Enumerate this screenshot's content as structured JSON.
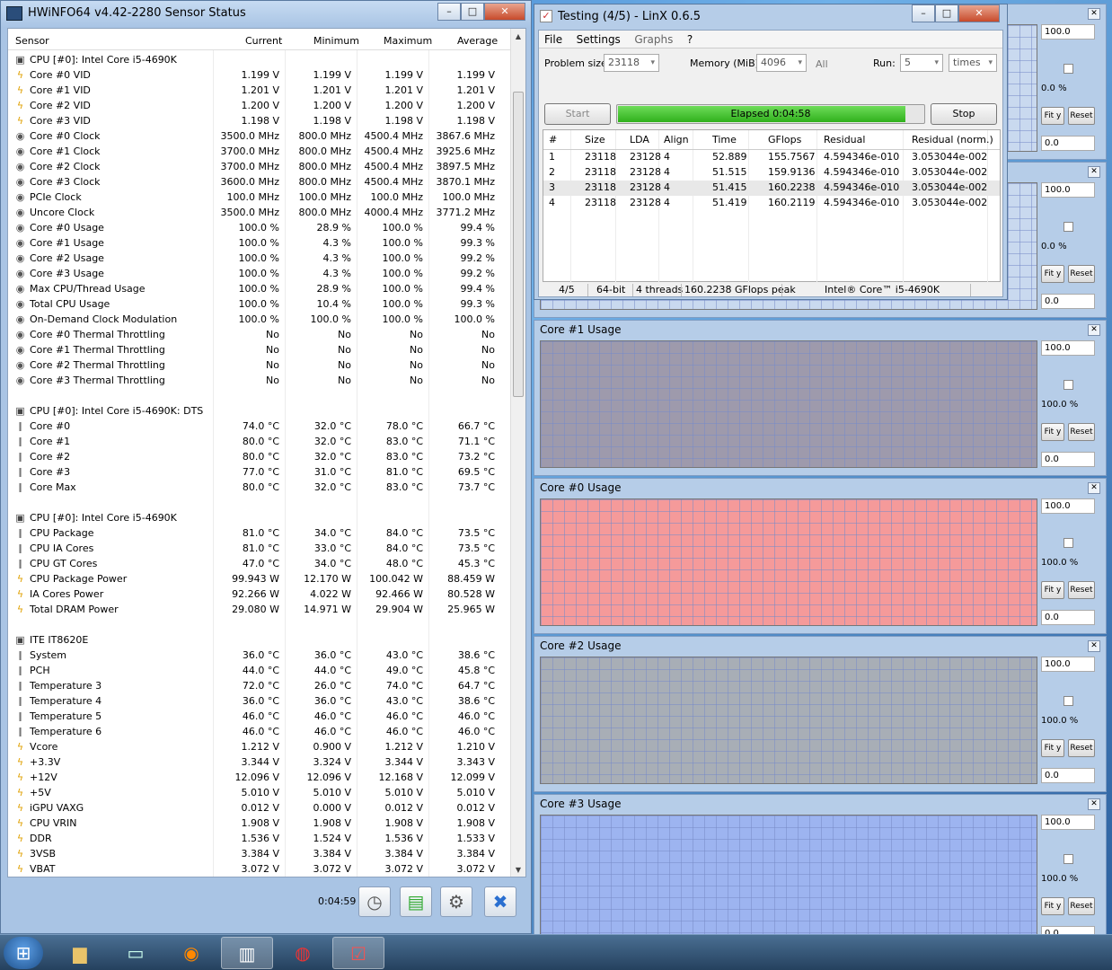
{
  "hwinfo": {
    "title": "HWiNFO64 v4.42-2280 Sensor Status",
    "columns": [
      "Sensor",
      "Current",
      "Minimum",
      "Maximum",
      "Average"
    ],
    "rows": [
      {
        "i": "cpu",
        "n": "CPU [#0]: Intel Core i5-4690K",
        "g": true
      },
      {
        "i": "volt",
        "n": "Core #0 VID",
        "v": [
          "1.199 V",
          "1.199 V",
          "1.199 V",
          "1.199 V"
        ]
      },
      {
        "i": "volt",
        "n": "Core #1 VID",
        "v": [
          "1.201 V",
          "1.201 V",
          "1.201 V",
          "1.201 V"
        ]
      },
      {
        "i": "volt",
        "n": "Core #2 VID",
        "v": [
          "1.200 V",
          "1.200 V",
          "1.200 V",
          "1.200 V"
        ]
      },
      {
        "i": "volt",
        "n": "Core #3 VID",
        "v": [
          "1.198 V",
          "1.198 V",
          "1.198 V",
          "1.198 V"
        ]
      },
      {
        "i": "clock",
        "n": "Core #0 Clock",
        "v": [
          "3500.0 MHz",
          "800.0 MHz",
          "4500.4 MHz",
          "3867.6 MHz"
        ]
      },
      {
        "i": "clock",
        "n": "Core #1 Clock",
        "v": [
          "3700.0 MHz",
          "800.0 MHz",
          "4500.4 MHz",
          "3925.6 MHz"
        ]
      },
      {
        "i": "clock",
        "n": "Core #2 Clock",
        "v": [
          "3700.0 MHz",
          "800.0 MHz",
          "4500.4 MHz",
          "3897.5 MHz"
        ]
      },
      {
        "i": "clock",
        "n": "Core #3 Clock",
        "v": [
          "3600.0 MHz",
          "800.0 MHz",
          "4500.4 MHz",
          "3870.1 MHz"
        ]
      },
      {
        "i": "clock",
        "n": "PCIe Clock",
        "v": [
          "100.0 MHz",
          "100.0 MHz",
          "100.0 MHz",
          "100.0 MHz"
        ]
      },
      {
        "i": "clock",
        "n": "Uncore Clock",
        "v": [
          "3500.0 MHz",
          "800.0 MHz",
          "4000.4 MHz",
          "3771.2 MHz"
        ]
      },
      {
        "i": "clock",
        "n": "Core #0 Usage",
        "v": [
          "100.0 %",
          "28.9 %",
          "100.0 %",
          "99.4 %"
        ]
      },
      {
        "i": "clock",
        "n": "Core #1 Usage",
        "v": [
          "100.0 %",
          "4.3 %",
          "100.0 %",
          "99.3 %"
        ]
      },
      {
        "i": "clock",
        "n": "Core #2 Usage",
        "v": [
          "100.0 %",
          "4.3 %",
          "100.0 %",
          "99.2 %"
        ]
      },
      {
        "i": "clock",
        "n": "Core #3 Usage",
        "v": [
          "100.0 %",
          "4.3 %",
          "100.0 %",
          "99.2 %"
        ]
      },
      {
        "i": "clock",
        "n": "Max CPU/Thread Usage",
        "v": [
          "100.0 %",
          "28.9 %",
          "100.0 %",
          "99.4 %"
        ]
      },
      {
        "i": "clock",
        "n": "Total CPU Usage",
        "v": [
          "100.0 %",
          "10.4 %",
          "100.0 %",
          "99.3 %"
        ]
      },
      {
        "i": "clock",
        "n": "On-Demand Clock Modulation",
        "v": [
          "100.0 %",
          "100.0 %",
          "100.0 %",
          "100.0 %"
        ]
      },
      {
        "i": "clock",
        "n": "Core #0 Thermal Throttling",
        "v": [
          "No",
          "No",
          "No",
          "No"
        ]
      },
      {
        "i": "clock",
        "n": "Core #1 Thermal Throttling",
        "v": [
          "No",
          "No",
          "No",
          "No"
        ]
      },
      {
        "i": "clock",
        "n": "Core #2 Thermal Throttling",
        "v": [
          "No",
          "No",
          "No",
          "No"
        ]
      },
      {
        "i": "clock",
        "n": "Core #3 Thermal Throttling",
        "v": [
          "No",
          "No",
          "No",
          "No"
        ]
      },
      {
        "i": "",
        "n": "",
        "sp": true
      },
      {
        "i": "cpu",
        "n": "CPU [#0]: Intel Core i5-4690K: DTS",
        "g": true
      },
      {
        "i": "temp",
        "n": "Core #0",
        "v": [
          "74.0 °C",
          "32.0 °C",
          "78.0 °C",
          "66.7 °C"
        ]
      },
      {
        "i": "temp",
        "n": "Core #1",
        "v": [
          "80.0 °C",
          "32.0 °C",
          "83.0 °C",
          "71.1 °C"
        ]
      },
      {
        "i": "temp",
        "n": "Core #2",
        "v": [
          "80.0 °C",
          "32.0 °C",
          "83.0 °C",
          "73.2 °C"
        ]
      },
      {
        "i": "temp",
        "n": "Core #3",
        "v": [
          "77.0 °C",
          "31.0 °C",
          "81.0 °C",
          "69.5 °C"
        ]
      },
      {
        "i": "temp",
        "n": "Core Max",
        "v": [
          "80.0 °C",
          "32.0 °C",
          "83.0 °C",
          "73.7 °C"
        ]
      },
      {
        "i": "",
        "n": "",
        "sp": true
      },
      {
        "i": "cpu",
        "n": "CPU [#0]: Intel Core i5-4690K",
        "g": true
      },
      {
        "i": "temp",
        "n": "CPU Package",
        "v": [
          "81.0 °C",
          "34.0 °C",
          "84.0 °C",
          "73.5 °C"
        ]
      },
      {
        "i": "temp",
        "n": "CPU IA Cores",
        "v": [
          "81.0 °C",
          "33.0 °C",
          "84.0 °C",
          "73.5 °C"
        ]
      },
      {
        "i": "temp",
        "n": "CPU GT Cores",
        "v": [
          "47.0 °C",
          "34.0 °C",
          "48.0 °C",
          "45.3 °C"
        ]
      },
      {
        "i": "volt",
        "n": "CPU Package Power",
        "v": [
          "99.943 W",
          "12.170 W",
          "100.042 W",
          "88.459 W"
        ]
      },
      {
        "i": "volt",
        "n": "IA Cores Power",
        "v": [
          "92.266 W",
          "4.022 W",
          "92.466 W",
          "80.528 W"
        ]
      },
      {
        "i": "volt",
        "n": "Total DRAM Power",
        "v": [
          "29.080 W",
          "14.971 W",
          "29.904 W",
          "25.965 W"
        ]
      },
      {
        "i": "",
        "n": "",
        "sp": true
      },
      {
        "i": "cpu",
        "n": "ITE IT8620E",
        "g": true
      },
      {
        "i": "temp",
        "n": "System",
        "v": [
          "36.0 °C",
          "36.0 °C",
          "43.0 °C",
          "38.6 °C"
        ]
      },
      {
        "i": "temp",
        "n": "PCH",
        "v": [
          "44.0 °C",
          "44.0 °C",
          "49.0 °C",
          "45.8 °C"
        ]
      },
      {
        "i": "temp",
        "n": "Temperature 3",
        "v": [
          "72.0 °C",
          "26.0 °C",
          "74.0 °C",
          "64.7 °C"
        ]
      },
      {
        "i": "temp",
        "n": "Temperature 4",
        "v": [
          "36.0 °C",
          "36.0 °C",
          "43.0 °C",
          "38.6 °C"
        ]
      },
      {
        "i": "temp",
        "n": "Temperature 5",
        "v": [
          "46.0 °C",
          "46.0 °C",
          "46.0 °C",
          "46.0 °C"
        ]
      },
      {
        "i": "temp",
        "n": "Temperature 6",
        "v": [
          "46.0 °C",
          "46.0 °C",
          "46.0 °C",
          "46.0 °C"
        ]
      },
      {
        "i": "volt",
        "n": "Vcore",
        "v": [
          "1.212 V",
          "0.900 V",
          "1.212 V",
          "1.210 V"
        ]
      },
      {
        "i": "volt",
        "n": "+3.3V",
        "v": [
          "3.344 V",
          "3.324 V",
          "3.344 V",
          "3.343 V"
        ]
      },
      {
        "i": "volt",
        "n": "+12V",
        "v": [
          "12.096 V",
          "12.096 V",
          "12.168 V",
          "12.099 V"
        ]
      },
      {
        "i": "volt",
        "n": "+5V",
        "v": [
          "5.010 V",
          "5.010 V",
          "5.010 V",
          "5.010 V"
        ]
      },
      {
        "i": "volt",
        "n": "iGPU VAXG",
        "v": [
          "0.012 V",
          "0.000 V",
          "0.012 V",
          "0.012 V"
        ]
      },
      {
        "i": "volt",
        "n": "CPU VRIN",
        "v": [
          "1.908 V",
          "1.908 V",
          "1.908 V",
          "1.908 V"
        ]
      },
      {
        "i": "volt",
        "n": "DDR",
        "v": [
          "1.536 V",
          "1.524 V",
          "1.536 V",
          "1.533 V"
        ]
      },
      {
        "i": "volt",
        "n": "3VSB",
        "v": [
          "3.384 V",
          "3.384 V",
          "3.384 V",
          "3.384 V"
        ]
      },
      {
        "i": "volt",
        "n": "VBAT",
        "v": [
          "3.072 V",
          "3.072 V",
          "3.072 V",
          "3.072 V"
        ]
      }
    ],
    "elapsed": "0:04:59"
  },
  "linx": {
    "title": "Testing (4/5) - LinX 0.6.5",
    "menu": [
      "File",
      "Settings",
      "Graphs",
      "?"
    ],
    "problem_size_label": "Problem size:",
    "problem_size": "23118",
    "memory_label": "Memory (MiB):",
    "memory": "4096",
    "all_label": "All",
    "run_label": "Run:",
    "run": "5",
    "times": "times",
    "start": "Start",
    "stop": "Stop",
    "elapsed": "Elapsed 0:04:58",
    "progress": 0.94,
    "columns": [
      "#",
      "Size",
      "LDA",
      "Align",
      "Time",
      "GFlops",
      "Residual",
      "Residual (norm.)"
    ],
    "results": [
      [
        "1",
        "23118",
        "23128",
        "4",
        "52.889",
        "155.7567",
        "4.594346e-010",
        "3.053044e-002"
      ],
      [
        "2",
        "23118",
        "23128",
        "4",
        "51.515",
        "159.9136",
        "4.594346e-010",
        "3.053044e-002"
      ],
      [
        "3",
        "23118",
        "23128",
        "4",
        "51.415",
        "160.2238",
        "4.594346e-010",
        "3.053044e-002"
      ],
      [
        "4",
        "23118",
        "23128",
        "4",
        "51.419",
        "160.2119",
        "4.594346e-010",
        "3.053044e-002"
      ]
    ],
    "status": [
      "4/5",
      "64-bit",
      "4 threads",
      "160.2238 GFlops peak",
      "Intel® Core™ i5-4690K"
    ]
  },
  "graphs": [
    {
      "title": "",
      "max": "100.0",
      "pct": "0.0 %",
      "min": "0.0",
      "color": "#c9d9ef"
    },
    {
      "title": "",
      "max": "100.0",
      "pct": "0.0 %",
      "min": "0.0",
      "color": "#c9d9ef"
    },
    {
      "title": "Core #1 Usage",
      "max": "100.0",
      "pct": "100.0 %",
      "min": "0.0",
      "color": "#9e9aac"
    },
    {
      "title": "Core #0 Usage",
      "max": "100.0",
      "pct": "100.0 %",
      "min": "0.0",
      "color": "#f59a9a"
    },
    {
      "title": "Core #2 Usage",
      "max": "100.0",
      "pct": "100.0 %",
      "min": "0.0",
      "color": "#a8aeb6"
    },
    {
      "title": "Core #3 Usage",
      "max": "100.0",
      "pct": "100.0 %",
      "min": "0.0",
      "color": "#9db4f0"
    }
  ],
  "graph_buttons": {
    "fit": "Fit y",
    "reset": "Reset"
  }
}
